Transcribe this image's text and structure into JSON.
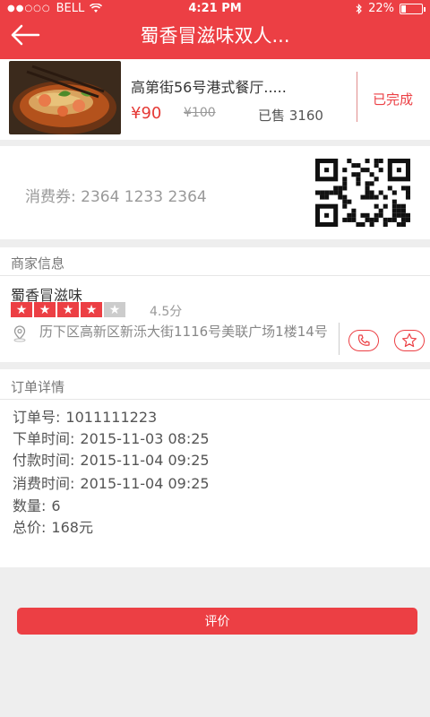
{
  "status_bar": {
    "carrier": "BELL",
    "time": "4:21 PM",
    "battery_percent": "22%",
    "battery_level": 0.22
  },
  "header": {
    "title": "蜀香冒滋味双人...",
    "back_icon": "arrow-left-icon"
  },
  "product": {
    "name": "高第街56号港式餐厅.....",
    "price": "¥90",
    "original_price": "¥100",
    "sold": "已售 3160",
    "status": "已完成"
  },
  "voucher": {
    "text": "消费券: 2364 1233 2364",
    "qr_icon": "qr-code-icon"
  },
  "merchant": {
    "section_title": "商家信息",
    "name": "蜀香冒滋味",
    "rating": "4.5分",
    "stars_on": 4,
    "stars_total": 5,
    "address": "历下区高新区新泺大街1116号美联广场1楼14号",
    "phone_icon": "phone-icon",
    "favorite_icon": "star-icon"
  },
  "order": {
    "section_title": "订单详情",
    "lines": [
      {
        "label": "订单号:",
        "value": "1011111223"
      },
      {
        "label": "下单时间:",
        "value": "2015-11-03  08:25"
      },
      {
        "label": "付款时间:",
        "value": "2015-11-04  09:25"
      },
      {
        "label": "消费时间:",
        "value": "2015-11-04  09:25"
      },
      {
        "label": "数量:",
        "value": "6"
      },
      {
        "label": "总价:",
        "value": "168元"
      }
    ]
  },
  "actions": {
    "review_label": "评价"
  },
  "colors": {
    "accent": "#ec3f44",
    "background": "#eeeeee"
  }
}
